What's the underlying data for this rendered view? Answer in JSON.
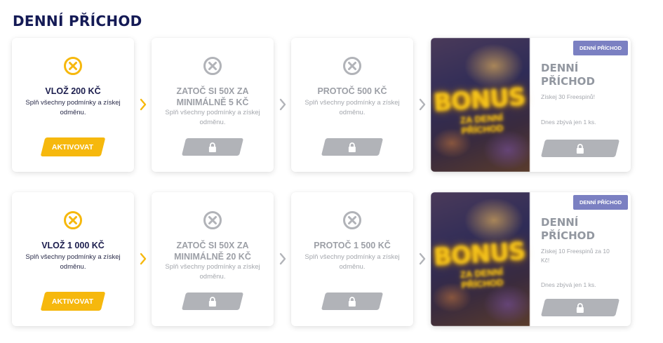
{
  "page": {
    "title": "DENNÍ PŘÍCHOD"
  },
  "colors": {
    "accent": "#f6b80d",
    "title": "#141a55",
    "locked": "#b1b3b8",
    "badge": "#7b80c2"
  },
  "rows": [
    {
      "steps": [
        {
          "icon": "x-circle-icon",
          "title": "VLOŽ 200 KČ",
          "desc": "Splň všechny podmínky a získej odměnu.",
          "button": "AKTIVOVAT",
          "state": "active"
        },
        {
          "icon": "x-circle-icon",
          "title": "ZATOČ SI 50X ZA MINIMÁLNĚ 5 KČ",
          "desc": "Splň všechny podmínky a získej odměnu.",
          "state": "locked"
        },
        {
          "icon": "x-circle-icon",
          "title": "PROTOČ 500 KČ",
          "desc": "Splň všechny podmínky a získej odměnu.",
          "state": "locked"
        }
      ],
      "reward": {
        "badge": "DENNÍ PŘÍCHOD",
        "image_text": "BONUS",
        "image_sub": "ZA DENNÍ PŘÍCHOD",
        "title": "DENNÍ PŘÍCHOD",
        "desc": "Získej 30 Freespinů!",
        "stock": "Dnes zbývá jen 1 ks."
      }
    },
    {
      "steps": [
        {
          "icon": "x-circle-icon",
          "title": "VLOŽ 1 000 KČ",
          "desc": "Splň všechny podmínky a získej odměnu.",
          "button": "AKTIVOVAT",
          "state": "active"
        },
        {
          "icon": "x-circle-icon",
          "title": "ZATOČ SI 50X ZA MINIMÁLNĚ 20 KČ",
          "desc": "Splň všechny podmínky a získej odměnu.",
          "state": "locked"
        },
        {
          "icon": "x-circle-icon",
          "title": "PROTOČ 1 500 KČ",
          "desc": "Splň všechny podmínky a získej odměnu.",
          "state": "locked"
        }
      ],
      "reward": {
        "badge": "DENNÍ PŘÍCHOD",
        "image_text": "BONUS",
        "image_sub": "ZA DENNÍ PŘÍCHOD",
        "title": "DENNÍ PŘÍCHOD",
        "desc": "Získej 10 Freespinů za 10 Kč!",
        "stock": "Dnes zbývá jen 1 ks."
      }
    }
  ]
}
